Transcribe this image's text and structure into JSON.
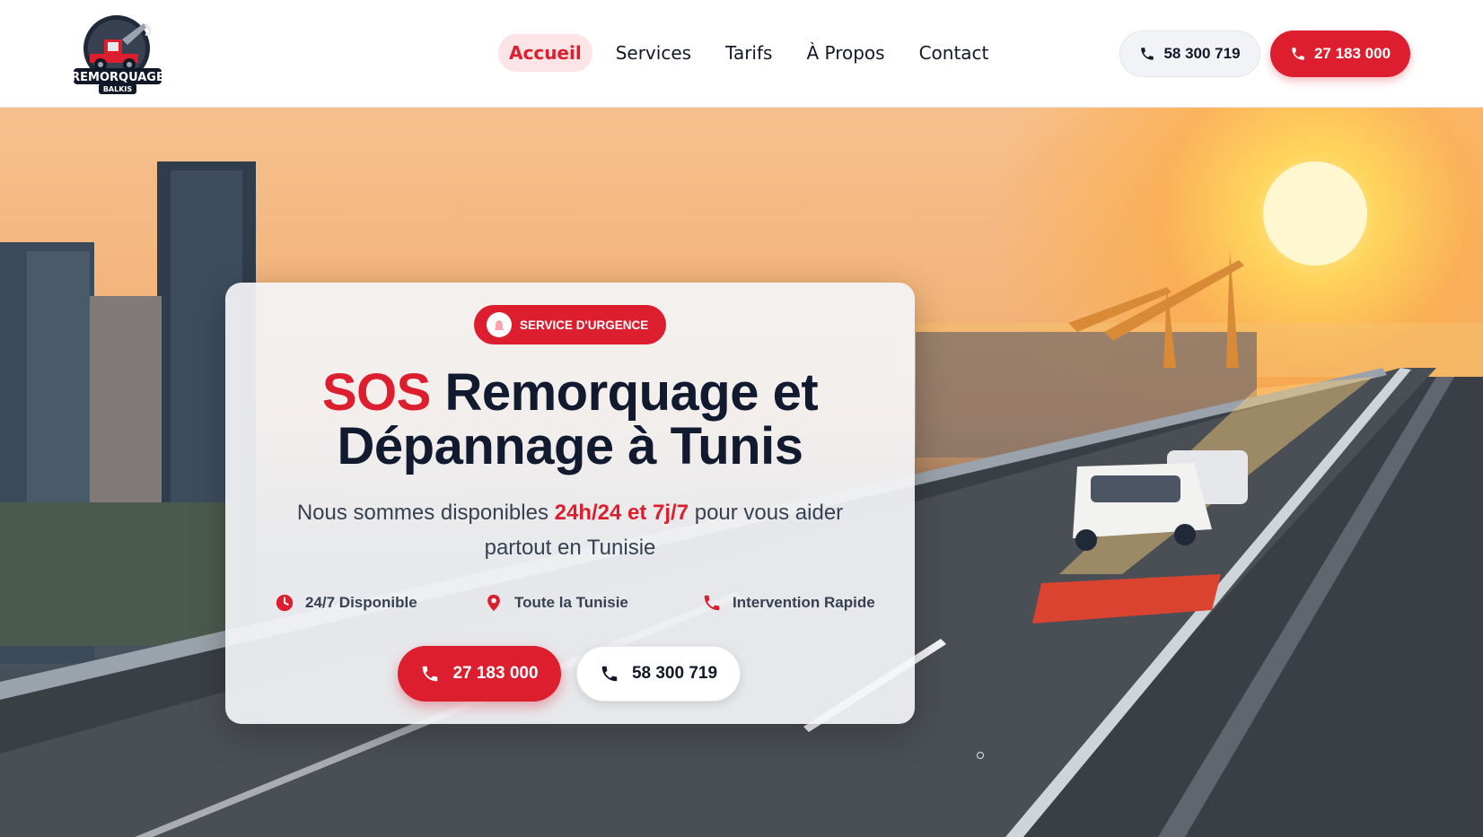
{
  "brand": {
    "logo_text": "REMORQUAGE",
    "logo_subtext": "BALKIS"
  },
  "nav": {
    "items": [
      {
        "label": "Accueil",
        "active": true
      },
      {
        "label": "Services",
        "active": false
      },
      {
        "label": "Tarifs",
        "active": false
      },
      {
        "label": "À Propos",
        "active": false
      },
      {
        "label": "Contact",
        "active": false
      }
    ]
  },
  "header_actions": {
    "phone_secondary": "58 300 719",
    "phone_primary": "27 183 000"
  },
  "hero": {
    "badge": "SERVICE D'URGENCE",
    "title_highlight": "SOS",
    "title_line1_rest": " Remorquage et",
    "title_line2": "Dépannage à Tunis",
    "subtitle_before": "Nous sommes disponibles ",
    "subtitle_highlight": "24h/24 et 7j/7",
    "subtitle_after": " pour vous aider partout en Tunisie",
    "features": [
      {
        "icon": "clock-icon",
        "label": "24/7 Disponible"
      },
      {
        "icon": "map-pin-icon",
        "label": "Toute la Tunisie"
      },
      {
        "icon": "phone-icon",
        "label": "Intervention Rapide"
      }
    ],
    "cta_primary": "27 183 000",
    "cta_secondary": "58 300 719"
  },
  "colors": {
    "accent": "#dc1e2e",
    "text_dark": "#111a2e",
    "text_muted": "#374151",
    "nav_active_bg": "#fde4e6"
  }
}
